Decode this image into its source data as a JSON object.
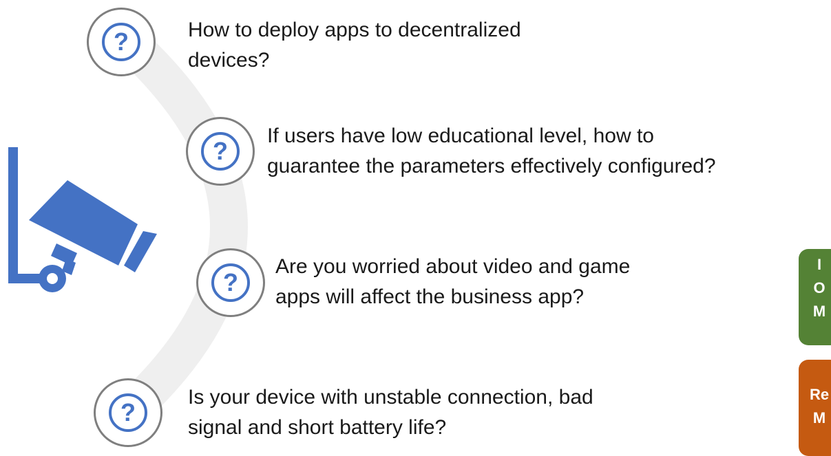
{
  "questions": [
    {
      "line1": "How to deploy apps to decentralized",
      "line2": "devices?",
      "icon": "question-icon"
    },
    {
      "line1": "If users have low educational level, how to",
      "line2": "guarantee the parameters effectively configured?",
      "icon": "question-icon"
    },
    {
      "line1": "Are you worried about video and game",
      "line2": "apps will affect the business app?",
      "icon": "question-icon"
    },
    {
      "line1": "Is your device with unstable connection, bad",
      "line2": "signal and short battery life?",
      "icon": "question-icon"
    }
  ],
  "question_mark": "?",
  "camera_icon": "security-camera-icon",
  "side_tiles": {
    "green": {
      "lines": [
        "I",
        "O",
        "M"
      ],
      "color": "#548235"
    },
    "orange": {
      "lines": [
        "Re",
        "M"
      ],
      "color": "#c55a11"
    }
  },
  "colors": {
    "accent": "#4472c4",
    "arc": "#efefef",
    "circle_border": "#7f7f7f"
  }
}
